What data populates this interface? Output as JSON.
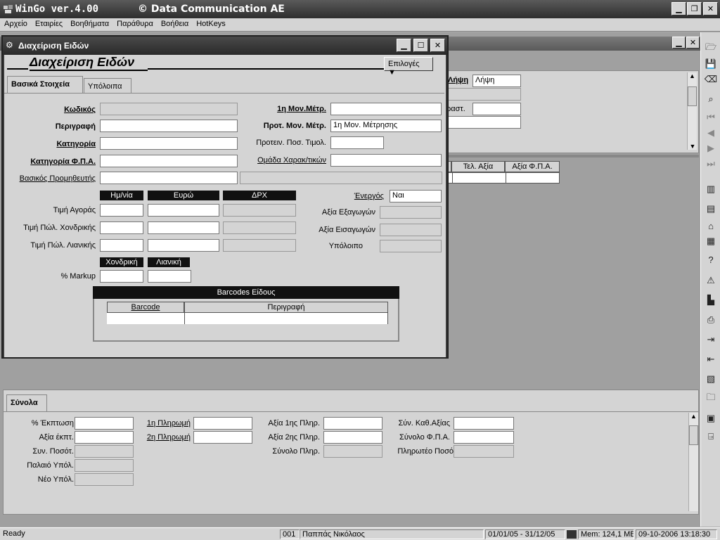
{
  "app": {
    "title": "WinGo ver.4.00",
    "company": "© Data Communication AE"
  },
  "menu": [
    "Αρχείο",
    "Εταιρίες",
    "Βοηθήματα",
    "Παράθυρα",
    "Βοήθεια",
    "HotKeys"
  ],
  "bg_window": {
    "labels": {
      "receive": "Λήψη",
      "receive_value": "Λήψη",
      "sales": "ραστ.",
      "col_net": "Τελ. Αξία",
      "col_vat": "Αξία Φ.Π.Α."
    }
  },
  "item_window": {
    "title": "Διαχείριση Ειδών",
    "heading": "Διαχείριση Ειδών",
    "options_button": "Επιλογές",
    "tabs": [
      "Βασικά Στοιχεία",
      "Υπόλοιπα"
    ],
    "fields": {
      "code": "Κωδικός",
      "description": "Περιγραφή",
      "category": "Κατηγορία",
      "vat_category": "Κατηγορία Φ.Π.Α.",
      "supplier": "Βασικός Προμηθευτής",
      "uom1": "1η Μον.Μέτρ.",
      "pref_uom": "Προτ. Μον. Μέτρ.",
      "pref_uom_value": "1η Μον. Μέτρησης",
      "pref_qty": "Προτειν. Ποσ. Τιμολ.",
      "char_group": "Ομάδα Χαρακ/τικών",
      "active": "Ένεργός",
      "active_value": "Ναι",
      "exports": "Αξία Εξαγωγών",
      "imports": "Αξία Εισαγωγών",
      "balance": "Υπόλοιπο"
    },
    "price_headers": [
      "Ημ/νία",
      "Ευρώ",
      "ΔΡΧ"
    ],
    "price_rows": [
      "Τιμή Αγοράς",
      "Τιμή Πώλ. Χονδρικής",
      "Τιμή Πώλ. Λιανικής"
    ],
    "markup_headers": [
      "Χονδρική",
      "Λιανική"
    ],
    "markup_label": "% Markup",
    "barcodes": {
      "title": "Barcodes Είδους",
      "columns": [
        "Barcode",
        "Περιγραφή"
      ]
    }
  },
  "totals": {
    "tab": "Σύνολα",
    "col1": [
      "% Έκπτωση",
      "Αξία έκπτ.",
      "Συν. Ποσότ.",
      "Παλαιό Υπόλ.",
      "Νέο Υπόλ."
    ],
    "col2": [
      "1η Πληρωμή",
      "2η Πληρωμή"
    ],
    "col3": [
      "Αξία 1ης Πληρ.",
      "Αξία 2ης Πληρ.",
      "Σύνολο Πληρ."
    ],
    "col4": [
      "Σύν. Καθ.Αξίας",
      "Σύνολο Φ.Π.Α.",
      "Πληρωτέο  Ποσό"
    ]
  },
  "status": {
    "ready": "Ready",
    "code": "001",
    "user": "Παππάς Νικόλαος",
    "period": "01/01/05 - 31/12/05",
    "mem": "Mem: 124,1 MB",
    "datetime": "09-10-2006 13:18:30"
  },
  "sidebar_icons": [
    "folder-open-icon",
    "save-icon",
    "eraser-icon",
    "binoculars-icon",
    "first-icon",
    "prev-icon",
    "next-icon",
    "last-icon",
    "books-icon",
    "form-icon",
    "bank-icon",
    "grid-icon",
    "help-icon",
    "warning-icon",
    "building-icon",
    "printer-icon",
    "enter-icon",
    "exit-icon",
    "report-icon",
    "open-folder-icon",
    "screen-icon",
    "door-icon"
  ]
}
